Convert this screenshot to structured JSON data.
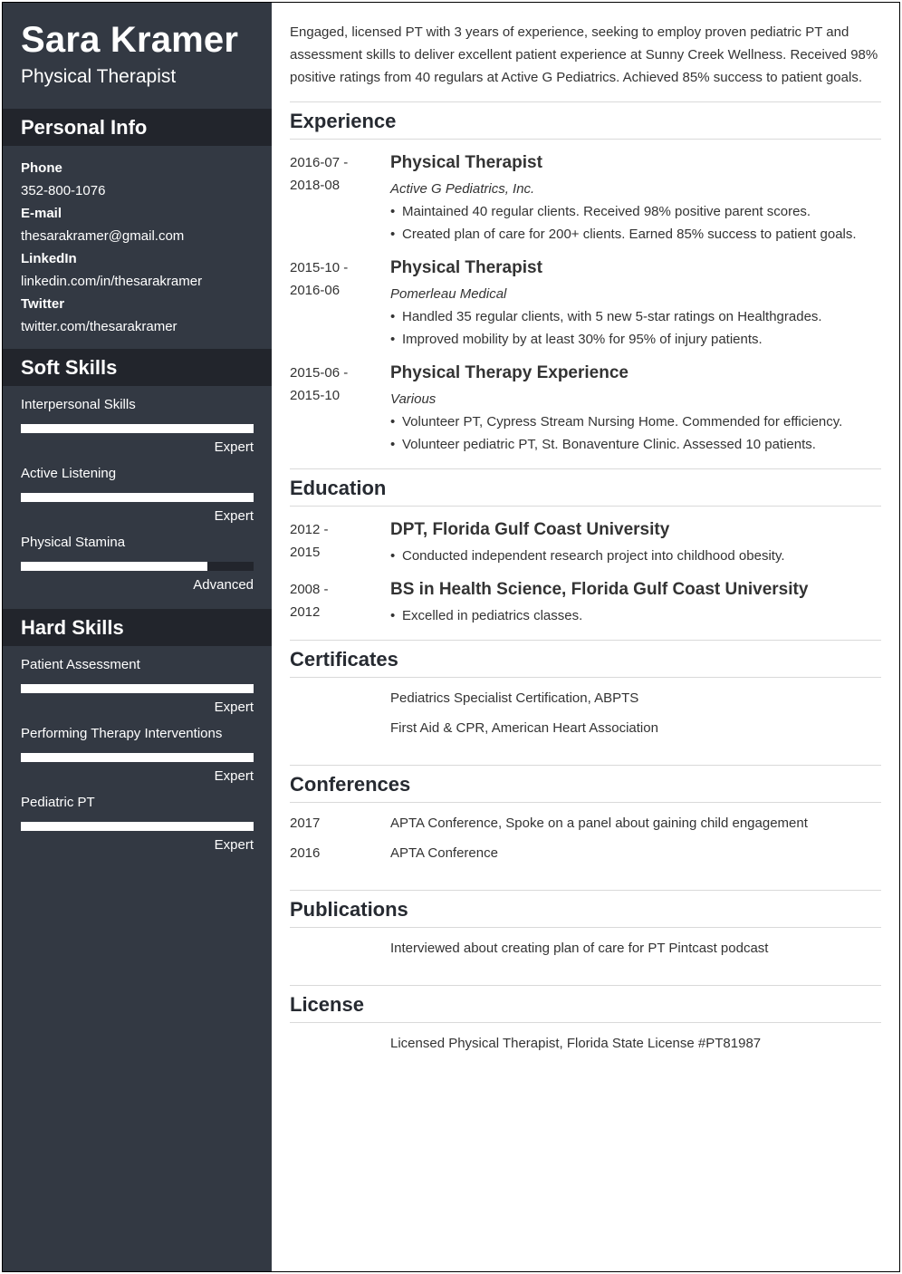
{
  "profile": {
    "name": "Sara Kramer",
    "role": "Physical Therapist"
  },
  "sidebar": {
    "personal_info": {
      "heading": "Personal Info",
      "items": [
        {
          "label": "Phone",
          "value": "352-800-1076"
        },
        {
          "label": "E-mail",
          "value": "thesarakramer@gmail.com"
        },
        {
          "label": "LinkedIn",
          "value": "linkedin.com/in/thesarakramer"
        },
        {
          "label": "Twitter",
          "value": "twitter.com/thesarakramer"
        }
      ]
    },
    "soft_skills": {
      "heading": "Soft Skills",
      "items": [
        {
          "name": "Interpersonal Skills",
          "level": "Expert",
          "fill": 1.0
        },
        {
          "name": "Active Listening",
          "level": "Expert",
          "fill": 1.0
        },
        {
          "name": "Physical Stamina",
          "level": "Advanced",
          "fill": 0.8
        }
      ]
    },
    "hard_skills": {
      "heading": "Hard Skills",
      "items": [
        {
          "name": "Patient Assessment",
          "level": "Expert",
          "fill": 1.0
        },
        {
          "name": "Performing Therapy Interventions",
          "level": "Expert",
          "fill": 1.0
        },
        {
          "name": "Pediatric PT",
          "level": "Expert",
          "fill": 1.0
        }
      ]
    }
  },
  "summary": "Engaged, licensed PT with 3 years of experience, seeking to employ proven pediatric PT and assessment skills to deliver excellent patient experience at Sunny Creek Wellness. Received 98% positive ratings from 40 regulars at Active G Pediatrics. Achieved 85% success to patient goals.",
  "experience": {
    "heading": "Experience",
    "entries": [
      {
        "date_start": "2016-07 -",
        "date_end": "2018-08",
        "title": "Physical Therapist",
        "org": "Active G Pediatrics, Inc.",
        "bullets": [
          "Maintained 40 regular clients. Received 98% positive parent scores.",
          "Created plan of care for 200+ clients. Earned 85% success to patient goals."
        ]
      },
      {
        "date_start": "2015-10 -",
        "date_end": "2016-06",
        "title": "Physical Therapist",
        "org": "Pomerleau Medical",
        "bullets": [
          "Handled 35 regular clients, with 5 new 5-star ratings on Healthgrades.",
          "Improved mobility by at least 30% for 95% of injury patients."
        ]
      },
      {
        "date_start": "2015-06 -",
        "date_end": "2015-10",
        "title": "Physical Therapy Experience",
        "org": "Various",
        "bullets": [
          "Volunteer PT, Cypress Stream Nursing Home. Commended for efficiency.",
          "Volunteer pediatric PT, St. Bonaventure Clinic. Assessed 10 patients."
        ]
      }
    ]
  },
  "education": {
    "heading": "Education",
    "entries": [
      {
        "date_start": "2012 -",
        "date_end": "2015",
        "title": "DPT, Florida Gulf Coast University",
        "bullets": [
          "Conducted independent research project into childhood obesity."
        ]
      },
      {
        "date_start": "2008 -",
        "date_end": "2012",
        "title": "BS in Health Science, Florida Gulf Coast University",
        "bullets": [
          "Excelled in pediatrics classes."
        ]
      }
    ]
  },
  "certificates": {
    "heading": "Certificates",
    "items": [
      {
        "date": "",
        "text": "Pediatrics Specialist Certification, ABPTS"
      },
      {
        "date": "",
        "text": "First Aid & CPR, American Heart Association"
      }
    ]
  },
  "conferences": {
    "heading": "Conferences",
    "items": [
      {
        "date": "2017",
        "text": "APTA Conference, Spoke on a panel about gaining child engagement"
      },
      {
        "date": "2016",
        "text": "APTA Conference"
      }
    ]
  },
  "publications": {
    "heading": "Publications",
    "items": [
      {
        "date": "",
        "text": "Interviewed about creating plan of care for PT Pintcast podcast"
      }
    ]
  },
  "license": {
    "heading": "License",
    "items": [
      {
        "date": "",
        "text": "Licensed Physical Therapist, Florida State License #PT81987"
      }
    ]
  },
  "colors": {
    "sidebar_bg": "#333943",
    "sidebar_heading_bg": "#22252c",
    "skill_fill": "#ffffff",
    "text": "#333333",
    "divider": "#d9d9d9"
  }
}
